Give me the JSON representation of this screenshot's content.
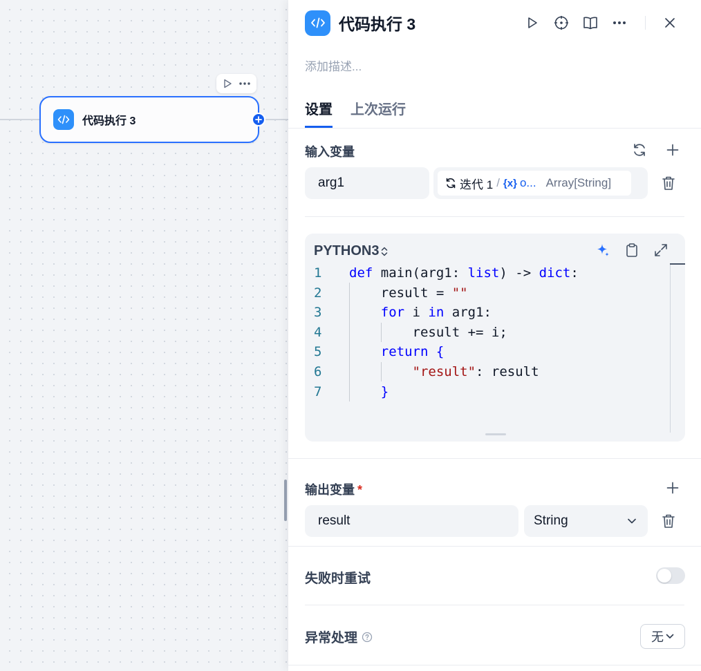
{
  "canvas": {
    "node": {
      "title": "代码执行 3",
      "icon": "code-icon"
    },
    "toolbar": {
      "run_icon": "play-icon",
      "more_icon": "more-icon"
    }
  },
  "panel": {
    "title": "代码执行 3",
    "description_placeholder": "添加描述...",
    "header_actions": [
      "play-icon",
      "locate-icon",
      "book-icon",
      "more-icon",
      "close-icon"
    ],
    "tabs": [
      {
        "label": "设置",
        "active": true
      },
      {
        "label": "上次运行",
        "active": false
      }
    ],
    "input": {
      "title": "输入变量",
      "variables": [
        {
          "name": "arg1",
          "ref_scope": "迭代 1",
          "ref_separator": "/",
          "ref_var_icon": "{x}",
          "ref_var": "o...",
          "ref_type": "Array[String]"
        }
      ]
    },
    "code": {
      "language": "PYTHON3",
      "line_numbers": [
        "1",
        "2",
        "3",
        "4",
        "5",
        "6",
        "7"
      ]
    },
    "output": {
      "title": "输出变量",
      "required_mark": "*",
      "variables": [
        {
          "name": "result",
          "type": "String"
        }
      ]
    },
    "retry": {
      "label": "失败时重试",
      "enabled": false
    },
    "error_handling": {
      "label": "异常处理",
      "value": "无"
    },
    "colors": {
      "accent": "#155eef",
      "icon_bg": "#2e90fa",
      "keyword": "#0000ff",
      "string": "#a31515"
    }
  }
}
